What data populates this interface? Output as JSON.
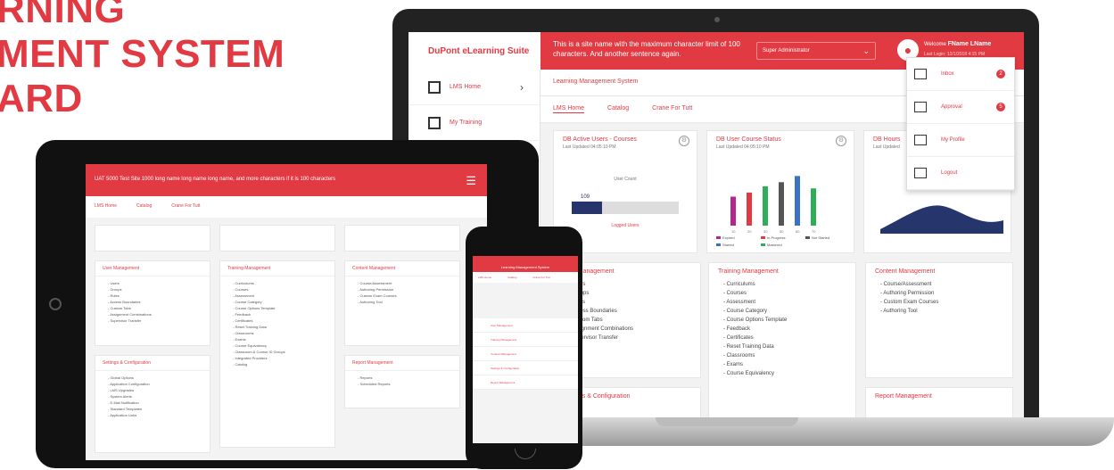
{
  "headline": [
    "RNING",
    "MENT SYSTEM",
    "ARD"
  ],
  "colors": {
    "brand_red": "#e23a43",
    "navy": "#26356b",
    "green": "#2fae5a",
    "purple": "#b5268f",
    "blue": "#3a73c6"
  },
  "laptop": {
    "brand": "DuPont eLearning Suite",
    "site_name": "This is a site name with the maximum character limit of 100 characters. And another sentence again.",
    "role_select": "Super Administrator",
    "welcome": "Welcome",
    "user": "FName LName",
    "last_login": "Last Login: 12/1/2018 4:15 PM",
    "sidebar": [
      {
        "label": "LMS Home",
        "icon": "home-screen-icon"
      },
      {
        "label": "My Training",
        "icon": "training-board-icon"
      }
    ],
    "page_title": "Learning Management System",
    "tabs": [
      "LMS Home",
      "Catalog",
      "Crane For Tutt"
    ],
    "cards": {
      "active_users": {
        "title": "DB Active Users - Courses",
        "sub": "Last Updated 04:05:10 PM",
        "caption": "User Count",
        "bar_value": "109",
        "footer": "Logged Users"
      },
      "course_status": {
        "title": "DB User Course Status",
        "sub": "Last Updated 04:05:10 PM"
      },
      "hours": {
        "title": "DB Hours",
        "sub": "Last Updated"
      },
      "user_mgmt": {
        "title": "User Management",
        "items": [
          "Users",
          "Groups",
          "Roles",
          "Access Boundaries",
          "Custom Tabs",
          "Assignment Combinations",
          "Supervisor Transfer"
        ]
      },
      "training_mgmt": {
        "title": "Training Management",
        "items": [
          "Curriculums",
          "Courses",
          "Assessment",
          "Course Category",
          "Course Options Template",
          "Feedback",
          "Certificates",
          "Reset Training Data",
          "Classrooms",
          "Exams",
          "Course Equivalency"
        ]
      },
      "content_mgmt": {
        "title": "Content Management",
        "items": [
          "Course/Assessment",
          "Authoring Permission",
          "Custom Exam Courses",
          "Authoring Tool"
        ]
      },
      "settings": {
        "title": "Settings & Configuration"
      },
      "report_mgmt": {
        "title": "Report Management"
      }
    },
    "dropdown": [
      {
        "label": "Inbox",
        "icon": "inbox-icon",
        "badge": "2"
      },
      {
        "label": "Approval",
        "icon": "approval-icon",
        "badge": "5"
      },
      {
        "label": "My Profile",
        "icon": "profile-icon",
        "badge": ""
      },
      {
        "label": "Logout",
        "icon": "logout-icon",
        "badge": ""
      }
    ]
  },
  "chart_data": {
    "type": "bar",
    "categories": [
      "1",
      "2",
      "3",
      "4",
      "5",
      "6"
    ],
    "values": [
      28,
      32,
      38,
      42,
      48,
      36
    ],
    "series_colors": [
      "#b5268f",
      "#e23a43",
      "#2fae5a",
      "#555555",
      "#3a73c6",
      "#2fae5a"
    ],
    "legend": [
      "Expired",
      "In Progress",
      "Not Started",
      "Started",
      "Mastered"
    ],
    "x_ticks": [
      "10",
      "20",
      "30",
      "50",
      "60",
      "70"
    ]
  },
  "tablet": {
    "site_name": "UAT 5000 Test Site 1000 long name long name long name, and more characters if it is 100 characters",
    "tabs": [
      "LMS Home",
      "Catalog",
      "Crane For Tutt"
    ],
    "user_mgmt": {
      "title": "User Management",
      "items": [
        "Users",
        "Groups",
        "Roles",
        "Access Boundaries",
        "Custom Tabs",
        "Assignment Combinations",
        "Supervisor Transfer"
      ]
    },
    "training_mgmt": {
      "title": "Training Management",
      "items": [
        "Curriculums",
        "Courses",
        "Assessment",
        "Course Category",
        "Course Options Template",
        "Feedback",
        "Certificates",
        "Reset Training Data",
        "Classrooms",
        "Exams",
        "Course Equivalency",
        "Classroom & Course ID Groups",
        "Integrated Providers",
        "Catalog"
      ]
    },
    "content_mgmt": {
      "title": "Content Management",
      "items": [
        "Course/Assessment",
        "Authoring Permission",
        "Custom Exam Courses",
        "Authoring Tool"
      ]
    },
    "settings": {
      "title": "Settings & Configuration",
      "items": [
        "Global Options",
        "Application Configuration",
        "LMS Upgrades",
        "System Alerts",
        "E-Mail Notification",
        "Standard Templates",
        "Application Links"
      ]
    },
    "report_mgmt": {
      "title": "Report Management",
      "items": [
        "Reports",
        "Scheduled Reports"
      ]
    }
  },
  "phone": {
    "title": "Learning Management System",
    "tabs": [
      "LMS Home",
      "Catalog",
      "Crane For Tutt"
    ],
    "rows": [
      "User Management",
      "Training Management",
      "Content Management",
      "Settings & Configuration",
      "Report Management"
    ]
  }
}
